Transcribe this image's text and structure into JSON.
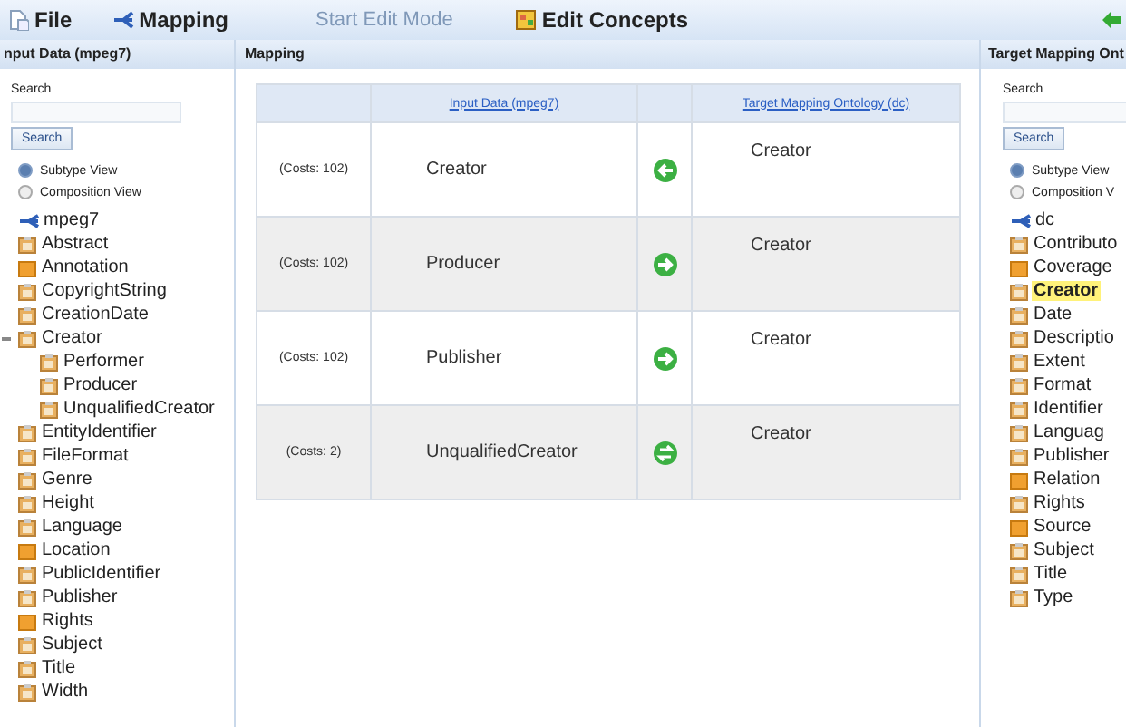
{
  "toolbar": {
    "items": [
      {
        "label": "File",
        "kind": "file",
        "disabled": false
      },
      {
        "label": "Mapping",
        "kind": "mapping",
        "disabled": false
      },
      {
        "label": "Start Edit Mode",
        "kind": "none",
        "disabled": true
      },
      {
        "label": "Edit Concepts",
        "kind": "concepts",
        "disabled": false
      }
    ]
  },
  "left_panel": {
    "title": "nput Data (mpeg7)",
    "search_label": "Search",
    "search_button": "Search",
    "views": [
      {
        "label": "Subtype View",
        "selected": true
      },
      {
        "label": "Composition View",
        "selected": false
      }
    ],
    "tree": {
      "label": "mpeg7",
      "children": [
        {
          "label": "Abstract",
          "kind": "concept"
        },
        {
          "label": "Annotation",
          "kind": "folder"
        },
        {
          "label": "CopyrightString",
          "kind": "concept"
        },
        {
          "label": "CreationDate",
          "kind": "concept"
        },
        {
          "label": "Creator",
          "kind": "concept",
          "expanded": true,
          "children": [
            {
              "label": "Performer",
              "kind": "concept"
            },
            {
              "label": "Producer",
              "kind": "concept"
            },
            {
              "label": "UnqualifiedCreator",
              "kind": "concept"
            }
          ]
        },
        {
          "label": "EntityIdentifier",
          "kind": "concept"
        },
        {
          "label": "FileFormat",
          "kind": "concept"
        },
        {
          "label": "Genre",
          "kind": "concept"
        },
        {
          "label": "Height",
          "kind": "concept"
        },
        {
          "label": "Language",
          "kind": "concept"
        },
        {
          "label": "Location",
          "kind": "folder"
        },
        {
          "label": "PublicIdentifier",
          "kind": "concept"
        },
        {
          "label": "Publisher",
          "kind": "concept"
        },
        {
          "label": "Rights",
          "kind": "folder"
        },
        {
          "label": "Subject",
          "kind": "concept"
        },
        {
          "label": "Title",
          "kind": "concept"
        },
        {
          "label": "Width",
          "kind": "concept"
        }
      ]
    }
  },
  "mapping": {
    "title": "Mapping",
    "columns": [
      "Input Data (mpeg7)",
      "Target Mapping Ontology (dc)"
    ],
    "rows": [
      {
        "cost": "(Costs: 102)",
        "input": "Creator",
        "kind": "left",
        "target": "Creator"
      },
      {
        "cost": "(Costs: 102)",
        "input": "Producer",
        "kind": "right",
        "target": "Creator"
      },
      {
        "cost": "(Costs: 102)",
        "input": "Publisher",
        "kind": "right",
        "target": "Creator"
      },
      {
        "cost": "(Costs: 2)",
        "input": "UnqualifiedCreator",
        "kind": "both",
        "target": "Creator"
      }
    ]
  },
  "right_panel": {
    "title": "Target Mapping Ont",
    "search_label": "Search",
    "search_button": "Search",
    "views": [
      {
        "label": "Subtype View",
        "selected": true
      },
      {
        "label": "Composition V",
        "selected": false
      }
    ],
    "tree": {
      "label": "dc",
      "children": [
        {
          "label": "Contributo",
          "kind": "concept",
          "selected": false
        },
        {
          "label": "Coverage",
          "kind": "folder",
          "selected": false
        },
        {
          "label": "Creator",
          "kind": "concept",
          "selected": true
        },
        {
          "label": "Date",
          "kind": "concept",
          "selected": false
        },
        {
          "label": "Descriptio",
          "kind": "concept",
          "selected": false
        },
        {
          "label": "Extent",
          "kind": "concept",
          "selected": false
        },
        {
          "label": "Format",
          "kind": "concept",
          "selected": false
        },
        {
          "label": "Identifier",
          "kind": "concept",
          "selected": false
        },
        {
          "label": "Languag",
          "kind": "concept",
          "selected": false
        },
        {
          "label": "Publisher",
          "kind": "concept",
          "selected": false
        },
        {
          "label": "Relation",
          "kind": "folder",
          "selected": false
        },
        {
          "label": "Rights",
          "kind": "concept",
          "selected": false
        },
        {
          "label": "Source",
          "kind": "folder",
          "selected": false
        },
        {
          "label": "Subject",
          "kind": "concept",
          "selected": false
        },
        {
          "label": "Title",
          "kind": "concept",
          "selected": false
        },
        {
          "label": "Type",
          "kind": "concept",
          "selected": false
        }
      ]
    }
  }
}
